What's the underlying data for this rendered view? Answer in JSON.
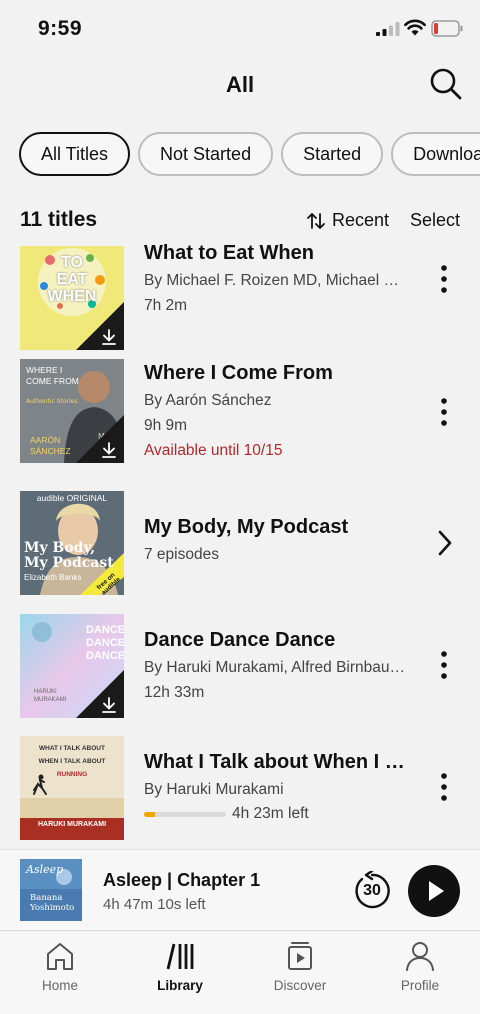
{
  "status": {
    "time": "9:59"
  },
  "header": {
    "title": "All"
  },
  "filters": [
    {
      "label": "All Titles",
      "active": true
    },
    {
      "label": "Not Started",
      "active": false
    },
    {
      "label": "Started",
      "active": false
    },
    {
      "label": "Downloaded",
      "active": false
    }
  ],
  "list_header": {
    "count": "11 titles",
    "sort": "Recent",
    "select": "Select"
  },
  "items": [
    {
      "title": "What to Eat When",
      "author": "By Michael F. Roizen MD, Michael Crupain MD",
      "length": "7h 2m",
      "cover_lines": [
        "TO",
        "EAT",
        "WHEN"
      ],
      "downloaded": true
    },
    {
      "title": "Where I Come From",
      "author": "By Aarón Sánchez",
      "length": "9h 9m",
      "availability": "Available until 10/15",
      "cover_lines": [
        "WHERE I",
        "COME FROM",
        "AARÓN",
        "SÁNCHEZ"
      ],
      "downloaded": true
    },
    {
      "title": "My Body, My Podcast",
      "episodes": "7 episodes",
      "cover_lines": [
        "audible ORIGINAL",
        "My Body,",
        "My Podcast",
        "Elizabeth Banks",
        "free on audible"
      ]
    },
    {
      "title": "Dance Dance Dance",
      "author": "By Haruki Murakami, Alfred Birnbaum (translator)",
      "length": "12h 33m",
      "cover_lines": [
        "DANCE",
        "DANCE",
        "DANCE",
        "HARUKI",
        "MURAKAMI"
      ],
      "downloaded": true
    },
    {
      "title": "What I Talk about When I Talk About Running",
      "author": "By Haruki Murakami",
      "time_left": "4h 23m left",
      "progress": 0.13,
      "cover_lines": [
        "WHAT I TALK ABOUT",
        "WHEN I TALK ABOUT",
        "RUNNING",
        "HARUKI MURAKAMI"
      ]
    }
  ],
  "mini_player": {
    "title": "Asleep | Chapter 1",
    "time_left": "4h 47m 10s left",
    "rewind": "30",
    "cover_lines": [
      "Asleep",
      "Banana",
      "Yoshimoto"
    ]
  },
  "tabs": [
    {
      "label": "Home",
      "active": false
    },
    {
      "label": "Library",
      "active": true
    },
    {
      "label": "Discover",
      "active": false
    },
    {
      "label": "Profile",
      "active": false
    }
  ],
  "colors": {
    "accent_red": "#b0282b",
    "progress": "#f0a800",
    "text": "#111111"
  }
}
